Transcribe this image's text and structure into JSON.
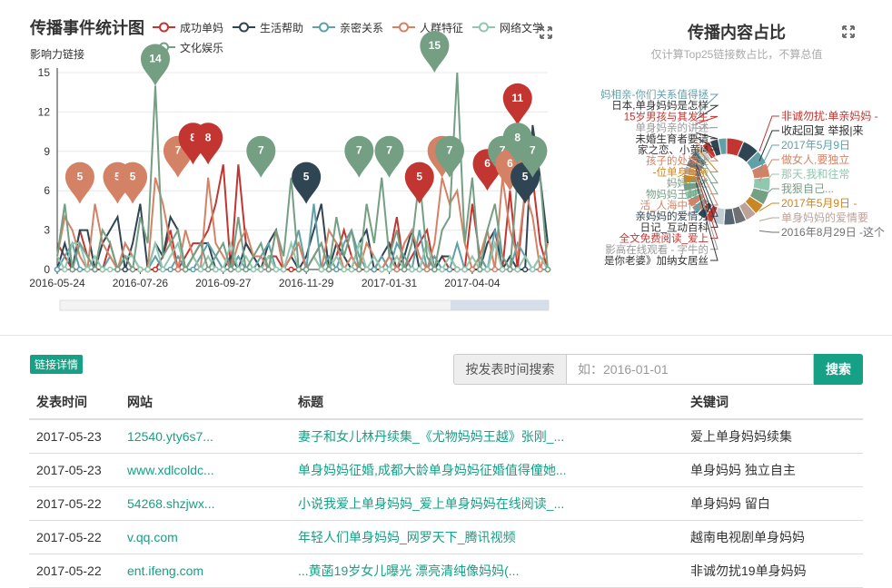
{
  "line_chart": {
    "title": "传播事件统计图",
    "ylabel": "影响力链接",
    "legend": [
      {
        "name": "成功单妈",
        "color": "#c23531"
      },
      {
        "name": "生活帮助",
        "color": "#2f4554"
      },
      {
        "name": "亲密关系",
        "color": "#61a0a8"
      },
      {
        "name": "人群特征",
        "color": "#d48265"
      },
      {
        "name": "网络文学",
        "color": "#91c7ae"
      },
      {
        "name": "文化娱乐",
        "color": "#749f83"
      }
    ],
    "icon": "expand-icon"
  },
  "pie_chart": {
    "title": "传播内容占比",
    "subtitle": "仅计算Top25链接数占比，不算总值",
    "icon": "expand-icon"
  },
  "chart_data": [
    {
      "type": "line",
      "ylim": [
        0,
        15
      ],
      "yticks": [
        0,
        3,
        6,
        9,
        12,
        15
      ],
      "xtick_labels": [
        "2016-05-24",
        "2016-07-26",
        "2016-09-27",
        "2016-11-29",
        "2017-01-31",
        "2017-04-04"
      ],
      "x_points": 66,
      "series": [
        {
          "name": "成功单妈",
          "values": [
            2,
            1,
            0,
            3,
            1,
            0,
            0,
            2,
            0,
            1,
            0,
            0,
            0,
            0,
            1,
            3,
            0,
            1,
            2,
            2,
            3,
            5,
            8,
            0,
            8,
            2,
            1,
            0,
            1,
            1,
            0,
            0,
            0,
            0,
            1,
            2,
            0,
            1,
            3,
            1,
            0,
            0,
            0,
            0,
            1,
            4,
            0,
            1,
            2,
            3,
            0,
            1,
            0,
            0,
            0,
            5,
            1,
            0,
            2,
            0,
            6,
            0,
            6,
            7,
            2,
            0
          ]
        },
        {
          "name": "生活帮助",
          "values": [
            0,
            2,
            0,
            3,
            3,
            0,
            2,
            3,
            4,
            0,
            2,
            5,
            0,
            2,
            1,
            4,
            3,
            0,
            1,
            2,
            2,
            0,
            0,
            1,
            0,
            2,
            1,
            0,
            2,
            3,
            0,
            1,
            0,
            1,
            3,
            5,
            0,
            2,
            1,
            0,
            2,
            3,
            0,
            1,
            2,
            0,
            1,
            3,
            0,
            2,
            0,
            1,
            1,
            0,
            0,
            0,
            0,
            2,
            3,
            0,
            1,
            0,
            0,
            11,
            7,
            2
          ]
        },
        {
          "name": "亲密关系",
          "values": [
            0,
            1,
            2,
            0,
            0,
            1,
            0,
            1,
            0,
            2,
            1,
            0,
            0,
            1,
            0,
            0,
            1,
            0,
            0,
            1,
            2,
            1,
            0,
            0,
            1,
            0,
            0,
            1,
            2,
            0,
            0,
            1,
            3,
            0,
            5,
            0,
            1,
            0,
            2,
            3,
            1,
            0,
            0,
            1,
            0,
            2,
            1,
            0,
            3,
            0,
            1,
            0,
            0,
            2,
            0,
            0,
            1,
            0,
            3,
            1,
            0,
            2,
            1,
            0,
            1,
            0
          ]
        },
        {
          "name": "人群特征",
          "values": [
            1,
            4,
            3,
            1,
            0,
            5,
            2,
            1,
            0,
            2,
            1,
            0,
            0,
            7,
            5,
            2,
            0,
            3,
            1,
            0,
            7,
            2,
            1,
            0,
            2,
            3,
            1,
            1,
            0,
            3,
            0,
            1,
            2,
            0,
            1,
            0,
            3,
            2,
            0,
            1,
            0,
            2,
            1,
            0,
            1,
            0,
            2,
            3,
            1,
            0,
            2,
            7,
            5,
            6,
            2,
            0,
            1,
            3,
            0,
            7,
            3,
            1,
            6,
            4,
            0,
            2
          ]
        },
        {
          "name": "网络文学",
          "values": [
            1,
            0,
            2,
            2,
            0,
            1,
            0,
            0,
            0,
            1,
            1,
            0,
            0,
            2,
            0,
            1,
            2,
            0,
            1,
            0,
            1,
            0,
            0,
            2,
            0,
            1,
            0,
            0,
            1,
            0,
            0,
            2,
            0,
            0,
            1,
            0,
            0,
            1,
            0,
            0,
            2,
            0,
            1,
            0,
            0,
            1,
            0,
            0,
            0,
            2,
            0,
            0,
            1,
            0,
            0,
            1,
            0,
            0,
            2,
            0,
            0,
            0,
            1,
            0,
            1,
            0
          ]
        },
        {
          "name": "文化娱乐",
          "values": [
            1,
            5,
            0,
            2,
            1,
            0,
            3,
            2,
            0,
            1,
            0,
            4,
            2,
            14,
            1,
            2,
            3,
            0,
            1,
            2,
            0,
            1,
            2,
            0,
            4,
            0,
            1,
            2,
            0,
            3,
            1,
            7,
            0,
            0,
            1,
            2,
            0,
            4,
            1,
            3,
            0,
            5,
            2,
            7,
            1,
            3,
            0,
            2,
            7,
            1,
            0,
            3,
            4,
            15,
            2,
            7,
            0,
            3,
            5,
            1,
            0,
            7,
            8,
            6,
            7,
            0
          ]
        }
      ],
      "markers": [
        {
          "series": "人群特征",
          "value": 5,
          "index": 3
        },
        {
          "series": "人群特征",
          "value": 5,
          "index": 8
        },
        {
          "series": "人群特征",
          "value": 5,
          "index": 10
        },
        {
          "series": "文化娱乐",
          "value": 14,
          "index": 13
        },
        {
          "series": "人群特征",
          "value": 7,
          "index": 16
        },
        {
          "series": "成功单妈",
          "value": 8,
          "index": 18
        },
        {
          "series": "成功单妈",
          "value": 8,
          "index": 20
        },
        {
          "series": "文化娱乐",
          "value": 7,
          "index": 27
        },
        {
          "series": "生活帮助",
          "value": 5,
          "index": 33
        },
        {
          "series": "文化娱乐",
          "value": 7,
          "index": 40
        },
        {
          "series": "文化娱乐",
          "value": 7,
          "index": 44
        },
        {
          "series": "成功单妈",
          "value": 5,
          "index": 48
        },
        {
          "series": "文化娱乐",
          "value": 15,
          "index": 50
        },
        {
          "series": "人群特征",
          "value": 7,
          "index": 51
        },
        {
          "series": "文化娱乐",
          "value": 7,
          "index": 52
        },
        {
          "series": "成功单妈",
          "value": 6,
          "index": 57
        },
        {
          "series": "文化娱乐",
          "value": 7,
          "index": 59
        },
        {
          "series": "人群特征",
          "value": 6,
          "index": 60
        },
        {
          "series": "成功单妈",
          "value": 11,
          "index": 61
        },
        {
          "series": "生活帮助",
          "value": 5,
          "index": 62
        },
        {
          "series": "文化娱乐",
          "value": 8,
          "index": 61
        },
        {
          "series": "文化娱乐",
          "value": 7,
          "index": 63
        }
      ],
      "grid": true,
      "legend_position": "top"
    },
    {
      "type": "pie",
      "donut": true,
      "labels_left": [
        {
          "text": "妈相亲-你们关系值得拯",
          "color": "#61a0a8"
        },
        {
          "text": "日本,单身妈妈是怎样",
          "color": "#333"
        },
        {
          "text": "15岁男孩与其发生",
          "color": "#c23531"
        },
        {
          "text": "单身妈亲的讲述",
          "color": "#999"
        },
        {
          "text": "未婚生育者要请",
          "color": "#333"
        },
        {
          "text": "家之恋、小黄l4",
          "color": "#333"
        },
        {
          "text": "孩子的处境让",
          "color": "#d48265"
        },
        {
          "text": "-位单身母亲",
          "color": "#ca8622"
        },
        {
          "text": "妈妈自述",
          "color": "#749f83"
        },
        {
          "text": "物妈妈王越》",
          "color": "#749f83"
        },
        {
          "text": "活_人海中作品",
          "color": "#d48265"
        },
        {
          "text": "亲妈妈的爱情分",
          "color": "#2f4554"
        },
        {
          "text": "日记_互动百科",
          "color": "#333"
        },
        {
          "text": "全文免费阅读_爱上",
          "color": "#c23531"
        },
        {
          "text": "影高在线观看 - 字牛的",
          "color": "#999"
        },
        {
          "text": "是你老婆》加纳女居丝",
          "color": "#333"
        }
      ],
      "labels_right": [
        {
          "text": "非诚勿扰:单亲妈妈 -",
          "color": "#c23531"
        },
        {
          "text": "收起回复 举报|来",
          "color": "#333"
        },
        {
          "text": "2017年5月9日",
          "color": "#61a0a8"
        },
        {
          "text": "做女人,要独立",
          "color": "#d48265"
        },
        {
          "text": "那天,我和往常",
          "color": "#91c7ae"
        },
        {
          "text": "我狠自己...",
          "color": "#749f83"
        },
        {
          "text": "2017年5月9日 -",
          "color": "#ca8622"
        },
        {
          "text": "单身妈妈的爱情要",
          "color": "#bda29a"
        },
        {
          "text": "2016年8月29日 -这个",
          "color": "#6e7074"
        }
      ],
      "slices": [
        {
          "color": "#c23531",
          "value": 6
        },
        {
          "color": "#2f4554",
          "value": 6
        },
        {
          "color": "#61a0a8",
          "value": 5
        },
        {
          "color": "#d48265",
          "value": 5
        },
        {
          "color": "#91c7ae",
          "value": 5
        },
        {
          "color": "#749f83",
          "value": 5
        },
        {
          "color": "#ca8622",
          "value": 4
        },
        {
          "color": "#bda29a",
          "value": 4
        },
        {
          "color": "#6e7074",
          "value": 4
        },
        {
          "color": "#546570",
          "value": 4
        },
        {
          "color": "#c4ccd3",
          "value": 4
        },
        {
          "color": "#c23531",
          "value": 3
        },
        {
          "color": "#2f4554",
          "value": 3
        },
        {
          "color": "#61a0a8",
          "value": 3
        },
        {
          "color": "#d48265",
          "value": 3
        },
        {
          "color": "#91c7ae",
          "value": 3
        },
        {
          "color": "#749f83",
          "value": 3
        },
        {
          "color": "#ca8622",
          "value": 3
        },
        {
          "color": "#bda29a",
          "value": 3
        },
        {
          "color": "#6e7074",
          "value": 3
        },
        {
          "color": "#546570",
          "value": 3
        },
        {
          "color": "#c4ccd3",
          "value": 3
        },
        {
          "color": "#c23531",
          "value": 3
        },
        {
          "color": "#2f4554",
          "value": 3
        },
        {
          "color": "#61a0a8",
          "value": 3
        }
      ]
    }
  ],
  "details": {
    "badge": "链接详情",
    "search_label": "按发表时间搜索",
    "search_placeholder": "如：2016-01-01",
    "search_button": "搜索",
    "columns": [
      "发表时间",
      "网站",
      "标题",
      "关键词"
    ],
    "rows": [
      [
        "2017-05-23",
        "12540.yty6s7...",
        "妻子和女儿林丹续集_《尤物妈妈王越》张刚_...",
        "爱上单身妈妈续集"
      ],
      [
        "2017-05-23",
        "www.xdlcoldc...",
        "单身妈妈征婚,成都大龄单身妈妈征婚值得僮她...",
        "单身妈妈 独立自主"
      ],
      [
        "2017-05-22",
        "54268.shzjwx...",
        "小说我爱上单身妈妈_爱上单身妈妈在线阅读_...",
        "单身妈妈 留白"
      ],
      [
        "2017-05-22",
        "v.qq.com",
        "年轻人们单身妈妈_网罗天下_腾讯视频",
        "越南电视剧单身妈妈"
      ],
      [
        "2017-05-22",
        "ent.ifeng.com",
        "...黄菡19岁女儿曝光 漂亮清纯像妈妈(...",
        "非诚勿扰19单身妈妈"
      ]
    ]
  },
  "colors": {
    "accent": "#16a085",
    "border": "#dddddd"
  }
}
